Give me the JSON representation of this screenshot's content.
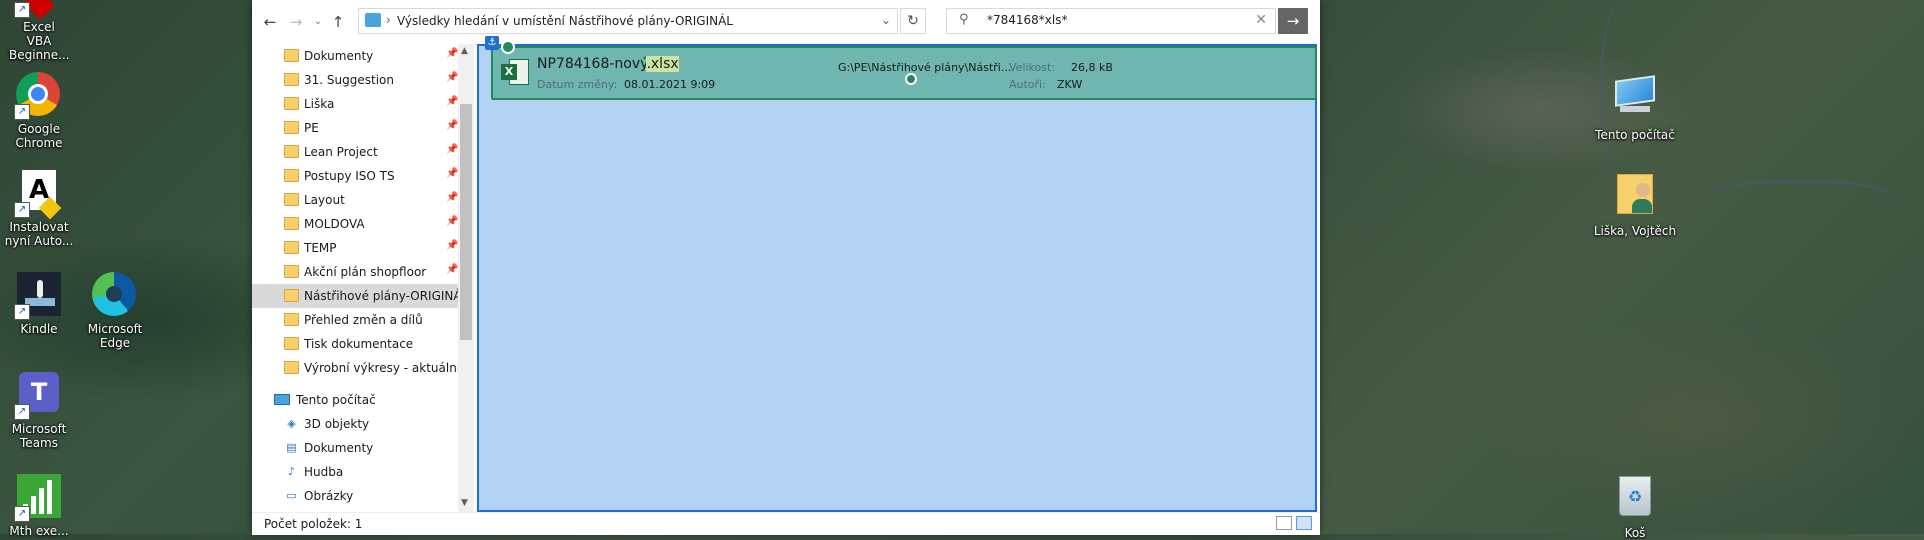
{
  "desktop": {
    "left_icons": [
      {
        "label": "Excel VBA Beginne...",
        "icon": "excel-vba-icon"
      },
      {
        "label": "Google Chrome",
        "icon": "chrome-icon"
      },
      {
        "label": "Instalovat nyní Auto...",
        "icon": "autocad-icon"
      },
      {
        "label": "Kindle",
        "icon": "kindle-icon"
      },
      {
        "label": "Microsoft Edge",
        "icon": "edge-icon"
      },
      {
        "label": "Microsoft Teams",
        "icon": "teams-icon"
      },
      {
        "label": "Mth exe...",
        "icon": "chart-app-icon"
      }
    ],
    "right_icons": [
      {
        "label": "Tento počítač",
        "icon": "this-pc-icon"
      },
      {
        "label": "Liška, Vojtěch",
        "icon": "user-folder-icon"
      },
      {
        "label": "Koš",
        "icon": "recycle-bin-icon"
      }
    ]
  },
  "explorer": {
    "address": {
      "breadcrumb": "Výsledky hledání v umístění Nástřihové plány-ORIGINÁL"
    },
    "search": {
      "value": "*784168*xls*"
    },
    "sidebar": {
      "quick_access": [
        {
          "label": "Dokumenty",
          "pinned": true
        },
        {
          "label": "31. Suggestion",
          "pinned": true
        },
        {
          "label": "Liška",
          "pinned": true
        },
        {
          "label": "PE",
          "pinned": true
        },
        {
          "label": "Lean Project",
          "pinned": true
        },
        {
          "label": "Postupy ISO TS",
          "pinned": true
        },
        {
          "label": "Layout",
          "pinned": true
        },
        {
          "label": "MOLDOVA",
          "pinned": true
        },
        {
          "label": "TEMP",
          "pinned": true
        },
        {
          "label": "Akční plán shopfloor",
          "pinned": true
        },
        {
          "label": "Nástřihové plány-ORIGINÁL",
          "pinned": false,
          "selected": true
        },
        {
          "label": "Přehled změn a dílů",
          "pinned": false
        },
        {
          "label": "Tisk dokumentace",
          "pinned": false
        },
        {
          "label": "Výrobní výkresy - aktuální",
          "pinned": false
        }
      ],
      "this_pc": "Tento počítač",
      "pc_items": [
        {
          "label": "3D objekty",
          "icon": "3d-objects-icon"
        },
        {
          "label": "Dokumenty",
          "icon": "documents-icon"
        },
        {
          "label": "Hudba",
          "icon": "music-icon"
        },
        {
          "label": "Obrázky",
          "icon": "pictures-icon"
        }
      ]
    },
    "result": {
      "name_prefix": "NP784168-nový",
      "name_ext": ".xlsx",
      "date_label": "Datum změny:",
      "date_value": "08.01.2021 9:09",
      "path": "G:\\PE\\Nástřihové plány\\Nástři...",
      "size_label": "Velikost:",
      "size_value": "26,8 kB",
      "author_label": "Autoři:",
      "author_value": "ZKW"
    },
    "status": {
      "count": "Počet položek: 1"
    }
  },
  "colors": {
    "selection": "#b3d1f3",
    "selection_border": "#1e6fd0",
    "result_bg": "#6fb6b0",
    "excel_green": "#1d6f42"
  }
}
